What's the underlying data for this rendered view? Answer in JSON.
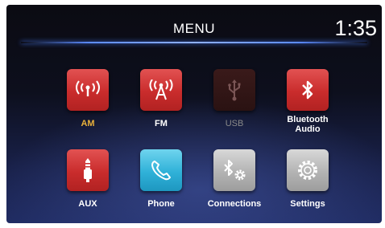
{
  "header": {
    "title": "MENU",
    "clock": "1:35"
  },
  "menu": {
    "am": "AM",
    "fm": "FM",
    "usb": "USB",
    "bluetooth_audio_line1": "Bluetooth",
    "bluetooth_audio_line2": "Audio",
    "aux": "AUX",
    "phone": "Phone",
    "connections": "Connections",
    "settings": "Settings"
  },
  "colors": {
    "accent_red": "#c92c2c",
    "active_label": "#e9b13a",
    "phone_blue": "#2fb1d8",
    "neutral_gray": "#b3b3b3",
    "divider_blue": "#5c8cff"
  },
  "icons": {
    "am": "broadcast-icon",
    "fm": "radio-tower-icon",
    "usb": "usb-icon",
    "bluetooth_audio": "bluetooth-icon",
    "aux": "aux-plug-icon",
    "phone": "phone-handset-icon",
    "connections": "bluetooth-gear-icon",
    "settings": "gear-icon"
  },
  "state": {
    "selected": "AM",
    "disabled": [
      "USB"
    ]
  }
}
